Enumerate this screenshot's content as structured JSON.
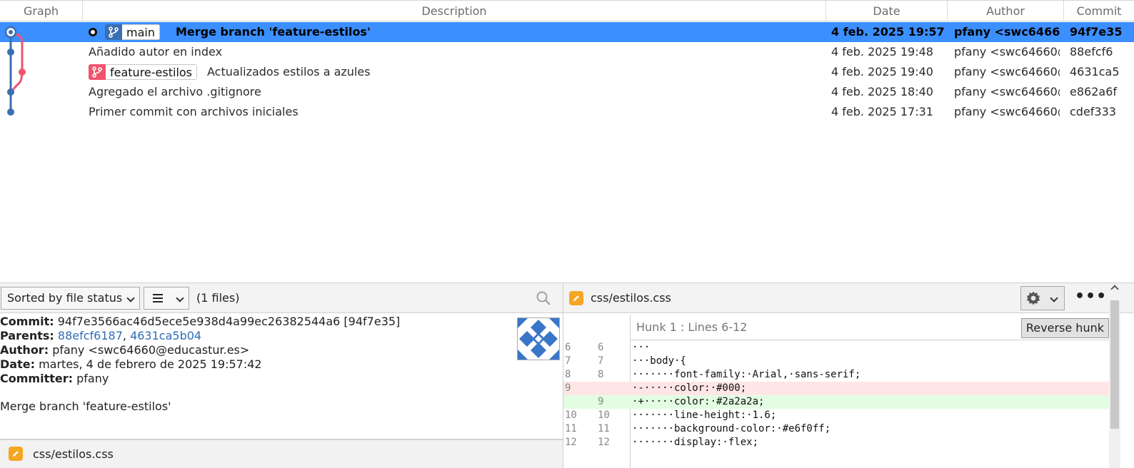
{
  "columns": {
    "graph": "Graph",
    "description": "Description",
    "date": "Date",
    "author": "Author",
    "commit": "Commit"
  },
  "commits": [
    {
      "description": "Merge branch 'feature-estilos'",
      "branch": "main",
      "date": "4 feb. 2025 19:57",
      "author": "pfany <swc64660",
      "hash": "94f7e35"
    },
    {
      "description": "Añadido autor en index",
      "date": "4 feb. 2025 19:48",
      "author": "pfany <swc64660@",
      "hash": "88efcf6"
    },
    {
      "description": "Actualizados estilos a azules",
      "branch": "feature-estilos",
      "date": "4 feb. 2025 19:40",
      "author": "pfany <swc64660@",
      "hash": "4631ca5"
    },
    {
      "description": "Agregado el archivo .gitignore",
      "date": "4 feb. 2025 18:40",
      "author": "pfany <swc64660@",
      "hash": "e862a6f"
    },
    {
      "description": "Primer commit con archivos iniciales",
      "date": "4 feb. 2025 17:31",
      "author": "pfany <swc64660@",
      "hash": "cdef333"
    }
  ],
  "colors": {
    "selected_row": "#3c8fff",
    "main_branch": "#3a6fb0",
    "feature_branch": "#f0546d",
    "file_modified": "#f5a623"
  },
  "file_panel": {
    "sort_label": "Sorted by file status",
    "files_count": "(1 files)",
    "files": [
      "css/estilos.css"
    ]
  },
  "details": {
    "commit_label": "Commit:",
    "commit_value": "94f7e3566ac46d5ece5e938d4a99ec26382544a6 [94f7e35]",
    "parents_label": "Parents:",
    "parent1": "88efcf6187",
    "parent_sep": ",",
    "parent2": "4631ca5b04",
    "author_label": "Author:",
    "author_value": "pfany <swc64660@educastur.es>",
    "date_label": "Date:",
    "date_value": "martes, 4 de febrero de 2025 19:57:42",
    "committer_label": "Committer:",
    "committer_value": "pfany",
    "message": "Merge branch 'feature-estilos'"
  },
  "diff": {
    "file": "css/estilos.css",
    "hunk_label": "Hunk 1 : Lines 6-12",
    "reverse_button": "Reverse hunk",
    "more_label": "•••",
    "lines": [
      {
        "old": "6",
        "new": "6",
        "type": "ctx",
        "text": "···"
      },
      {
        "old": "7",
        "new": "7",
        "type": "ctx",
        "text": "···body·{"
      },
      {
        "old": "8",
        "new": "8",
        "type": "ctx",
        "text": "·······font-family:·Arial,·sans-serif;"
      },
      {
        "old": "9",
        "new": "",
        "type": "del",
        "text": "·-·····color:·#000;"
      },
      {
        "old": "",
        "new": "9",
        "type": "add",
        "text": "·+·····color:·#2a2a2a;"
      },
      {
        "old": "10",
        "new": "10",
        "type": "ctx",
        "text": "·······line-height:·1.6;"
      },
      {
        "old": "11",
        "new": "11",
        "type": "ctx",
        "text": "·······background-color:·#e6f0ff;"
      },
      {
        "old": "12",
        "new": "12",
        "type": "ctx",
        "text": "·······display:·flex;"
      }
    ]
  }
}
